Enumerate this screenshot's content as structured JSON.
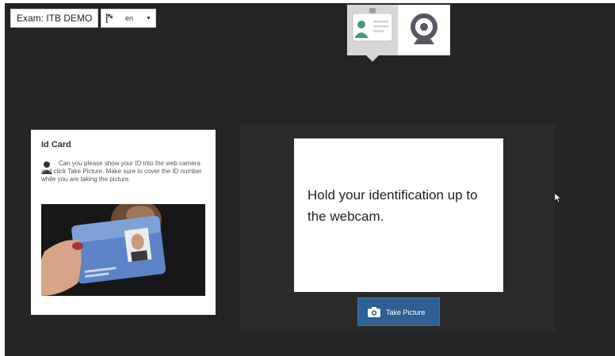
{
  "header": {
    "exam_label": "Exam: ITB DEMO",
    "language": {
      "selected": "en",
      "icon": "flag-icon"
    }
  },
  "steps": [
    {
      "name": "id-card",
      "icon": "id-badge-icon",
      "active": true
    },
    {
      "name": "webcam",
      "icon": "webcam-icon",
      "active": false
    }
  ],
  "id_panel": {
    "title": "Id Card",
    "icon": "user-icon",
    "instructions": "Can you please show your ID into the web camera and click Take Picture. Make sure to cover the ID number while you are taking the picture."
  },
  "camera": {
    "instruction": "Hold your identification up to the webcam.",
    "take_picture_label": "Take Picture",
    "button_icon": "camera-icon"
  },
  "colors": {
    "background": "#242424",
    "button": "#2f5f93",
    "tab_active": "#d7d7d7",
    "icon_teal": "#3f9a86",
    "icon_gray": "#555a63"
  }
}
